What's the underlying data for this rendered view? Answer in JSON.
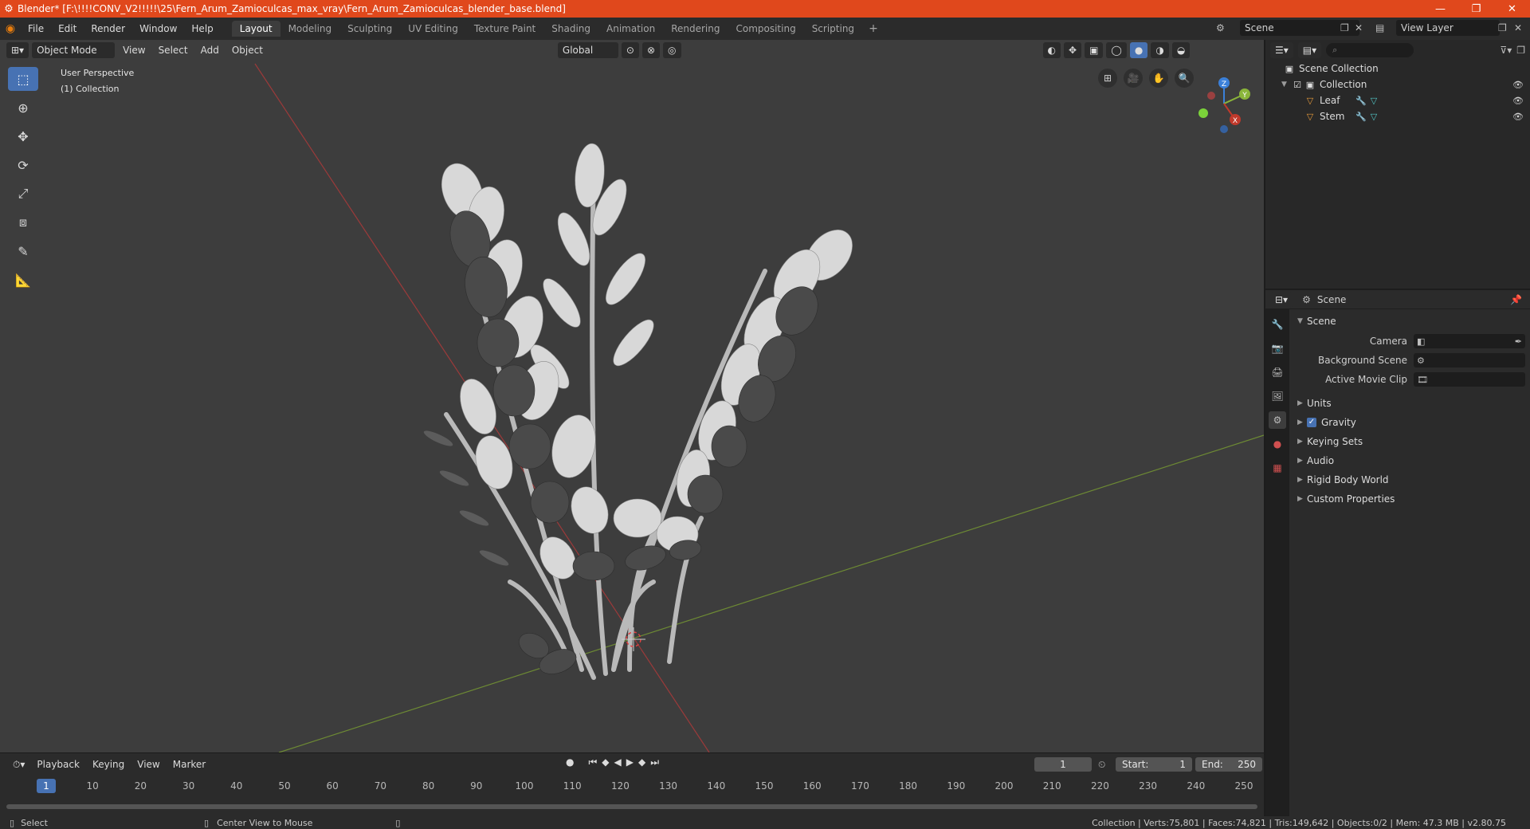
{
  "window": {
    "title": "Blender* [F:\\!!!!CONV_V2!!!!!\\25\\Fern_Arum_Zamioculcas_max_vray\\Fern_Arum_Zamioculcas_blender_base.blend]",
    "minimize": "—",
    "maximize": "❐",
    "close": "✕"
  },
  "menubar": {
    "items": [
      "File",
      "Edit",
      "Render",
      "Window",
      "Help"
    ],
    "workspaces": [
      "Layout",
      "Modeling",
      "Sculpting",
      "UV Editing",
      "Texture Paint",
      "Shading",
      "Animation",
      "Rendering",
      "Compositing",
      "Scripting"
    ],
    "add_tab": "+",
    "scene": "Scene",
    "view_layer": "View Layer"
  },
  "viewport": {
    "mode": "Object Mode",
    "menus": [
      "View",
      "Select",
      "Add",
      "Object"
    ],
    "transform": "Global",
    "perspective": "User Perspective",
    "collection": "(1) Collection",
    "gizmo": {
      "x": "X",
      "y": "Y",
      "z": "Z"
    }
  },
  "timeline": {
    "menus": [
      "Playback",
      "Keying",
      "View",
      "Marker"
    ],
    "current_frame": "1",
    "start_label": "Start:",
    "start": "1",
    "end_label": "End:",
    "end": "250",
    "ruler": [
      "10",
      "20",
      "30",
      "40",
      "50",
      "60",
      "70",
      "80",
      "90",
      "100",
      "110",
      "120",
      "130",
      "140",
      "150",
      "160",
      "170",
      "180",
      "190",
      "200",
      "210",
      "220",
      "230",
      "240",
      "250"
    ],
    "marker": "1"
  },
  "statusbar": {
    "select": "Select",
    "center_view": "Center View to Mouse",
    "stats": "Collection | Verts:75,801 | Faces:74,821 | Tris:149,642 | Objects:0/2 | Mem: 47.3 MB | v2.80.75"
  },
  "outliner": {
    "scene_collection": "Scene Collection",
    "collection": "Collection",
    "objects": [
      "Leaf",
      "Stem"
    ]
  },
  "properties": {
    "context": "Scene",
    "panel": "Scene",
    "camera_label": "Camera",
    "background_scene_label": "Background Scene",
    "active_movie_clip_label": "Active Movie Clip",
    "subpanels": [
      "Units",
      "Gravity",
      "Keying Sets",
      "Audio",
      "Rigid Body World",
      "Custom Properties"
    ]
  },
  "colors": {
    "title_bar": "#e0481c",
    "accent": "#4772b3",
    "axis_x": "#c0392b",
    "axis_y": "#8ab53a",
    "axis_z": "#3b80d9"
  }
}
